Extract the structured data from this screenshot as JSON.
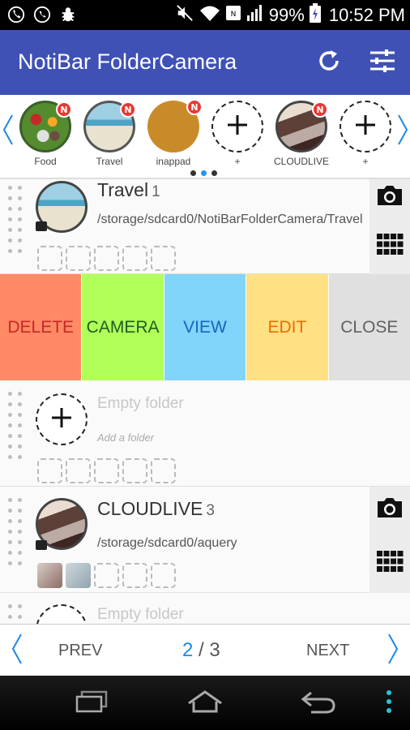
{
  "status_bar": {
    "battery": "99%",
    "time": "10:52 PM",
    "icons": [
      "phone-icon",
      "whatsapp-icon",
      "bug-icon",
      "mute-icon",
      "wifi-icon",
      "nfc-icon",
      "signal-icon",
      "battery-icon"
    ]
  },
  "app_bar": {
    "title": "NotiBar FolderCamera",
    "background": "#3f51b5",
    "actions": [
      "refresh-icon",
      "settings-sliders-icon"
    ]
  },
  "carousel": {
    "badge_text": "N",
    "items": [
      {
        "label": "Food",
        "badge": true,
        "kind": "photo"
      },
      {
        "label": "Travel",
        "badge": true,
        "kind": "photo"
      },
      {
        "label": "inappad",
        "badge": true,
        "kind": "color"
      },
      {
        "label": "+",
        "badge": false,
        "kind": "add"
      },
      {
        "label": "CLOUDLIVE",
        "badge": true,
        "kind": "photo"
      },
      {
        "label": "+",
        "badge": false,
        "kind": "add"
      }
    ],
    "page_dots": 3,
    "active_dot": 1
  },
  "folders": [
    {
      "title": "Travel",
      "count": "1",
      "path": "/storage/sdcard0/NotiBarFolderCamera/Travel"
    },
    {
      "empty_title": "Empty folder",
      "empty_sub": "Add a folder"
    },
    {
      "title": "CLOUDLIVE",
      "count": "3",
      "path": "/storage/sdcard0/aquery"
    },
    {
      "empty_title": "Empty folder"
    }
  ],
  "actions": [
    {
      "label": "DELETE",
      "bg": "#ff8a65",
      "fg": "#c62828"
    },
    {
      "label": "CAMERA",
      "bg": "#b2ff59",
      "fg": "#1b5e20"
    },
    {
      "label": "VIEW",
      "bg": "#81d4fa",
      "fg": "#1565c0"
    },
    {
      "label": "EDIT",
      "bg": "#ffe082",
      "fg": "#ef6c00"
    },
    {
      "label": "CLOSE",
      "bg": "#e0e0e0",
      "fg": "#616161"
    }
  ],
  "pager": {
    "prev": "PREV",
    "next": "NEXT",
    "current": "2",
    "separator": " / ",
    "total": "3"
  }
}
